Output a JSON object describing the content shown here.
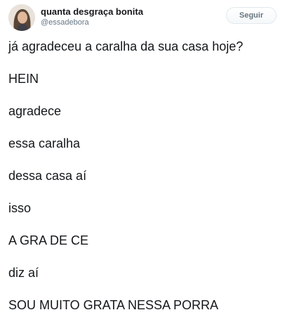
{
  "user": {
    "display_name": "quanta desgraça bonita",
    "handle": "@essadebora"
  },
  "follow_button": {
    "label": "Seguir"
  },
  "tweet": {
    "lines": [
      "já agradeceu a caralha da sua casa hoje?",
      "HEIN",
      "agradece",
      "essa caralha",
      "dessa casa aí",
      "isso",
      "A GRA DE CE",
      "diz aí",
      "SOU MUITO GRATA NESSA PORRA"
    ]
  },
  "colors": {
    "text": "#14171a",
    "muted": "#657786",
    "button_border": "#e1e8ed"
  }
}
